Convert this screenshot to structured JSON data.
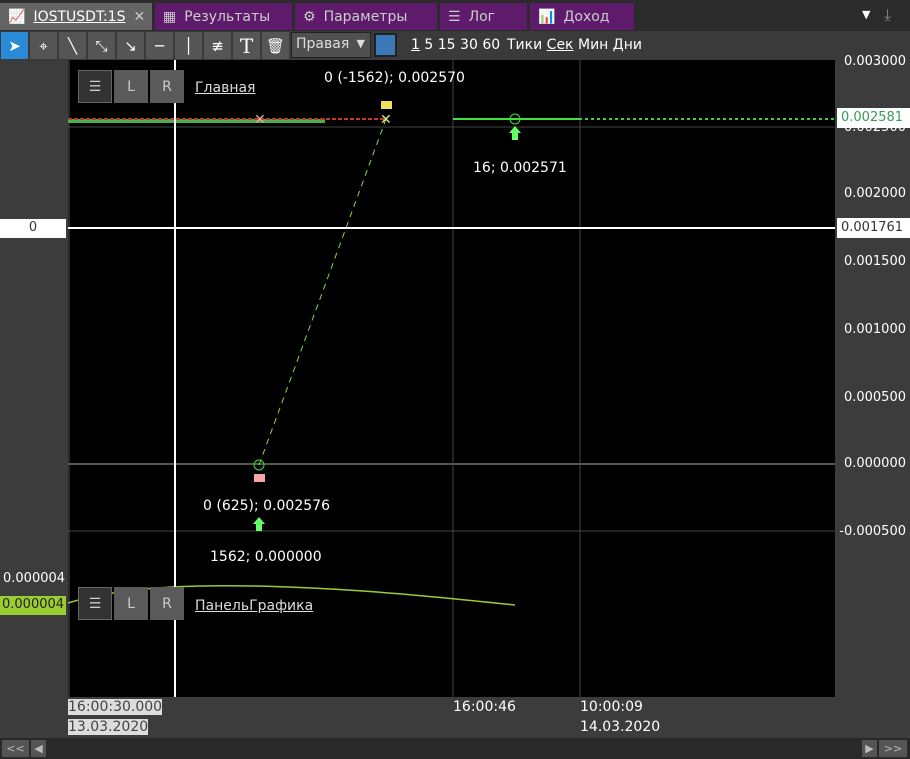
{
  "tabs": [
    {
      "label": "IOSTUSDT:1S",
      "icon": "chart-icon",
      "active": true
    },
    {
      "label": "Результаты",
      "icon": "grid-icon"
    },
    {
      "label": "Параметры",
      "icon": "gear-icon"
    },
    {
      "label": "Лог",
      "icon": "list-icon"
    },
    {
      "label": "Доход",
      "icon": "income-chart-icon"
    }
  ],
  "toolbar": {
    "axis_select": "Правая",
    "periods": [
      "1",
      "5",
      "15",
      "30",
      "60"
    ],
    "units": [
      "Тики",
      "Сек",
      "Мин",
      "Дни"
    ],
    "color": "#3a78b8"
  },
  "main_panel": {
    "title": "Главная",
    "btn_l": "L",
    "btn_r": "R"
  },
  "sub_panel": {
    "title": "ПанельГрафика",
    "btn_l": "L",
    "btn_r": "R",
    "value_top": "0.000004",
    "value_badge": "0.000004"
  },
  "right_axis": {
    "ticks": [
      "0.003000",
      "0.002500",
      "0.002000",
      "0.001500",
      "0.001000",
      "0.000500",
      "0.000000",
      "-0.000500"
    ],
    "price_badge": "0.002581",
    "crosshair_badge": "0.001761"
  },
  "left_axis": {
    "crosshair_badge": "0"
  },
  "annotations": {
    "top": "0 (-1562); 0.002570",
    "right": "16; 0.002571",
    "bottom1": "0 (625); 0.002576",
    "bottom2": "1562; 0.000000"
  },
  "x_axis": {
    "start_time": "16:00:30.000",
    "start_date": "13.03.2020",
    "mid_time": "16:00:46",
    "end_time": "10:00:09",
    "end_date": "14.03.2020"
  },
  "scroll": {
    "first": "<<",
    "last": ">>"
  }
}
